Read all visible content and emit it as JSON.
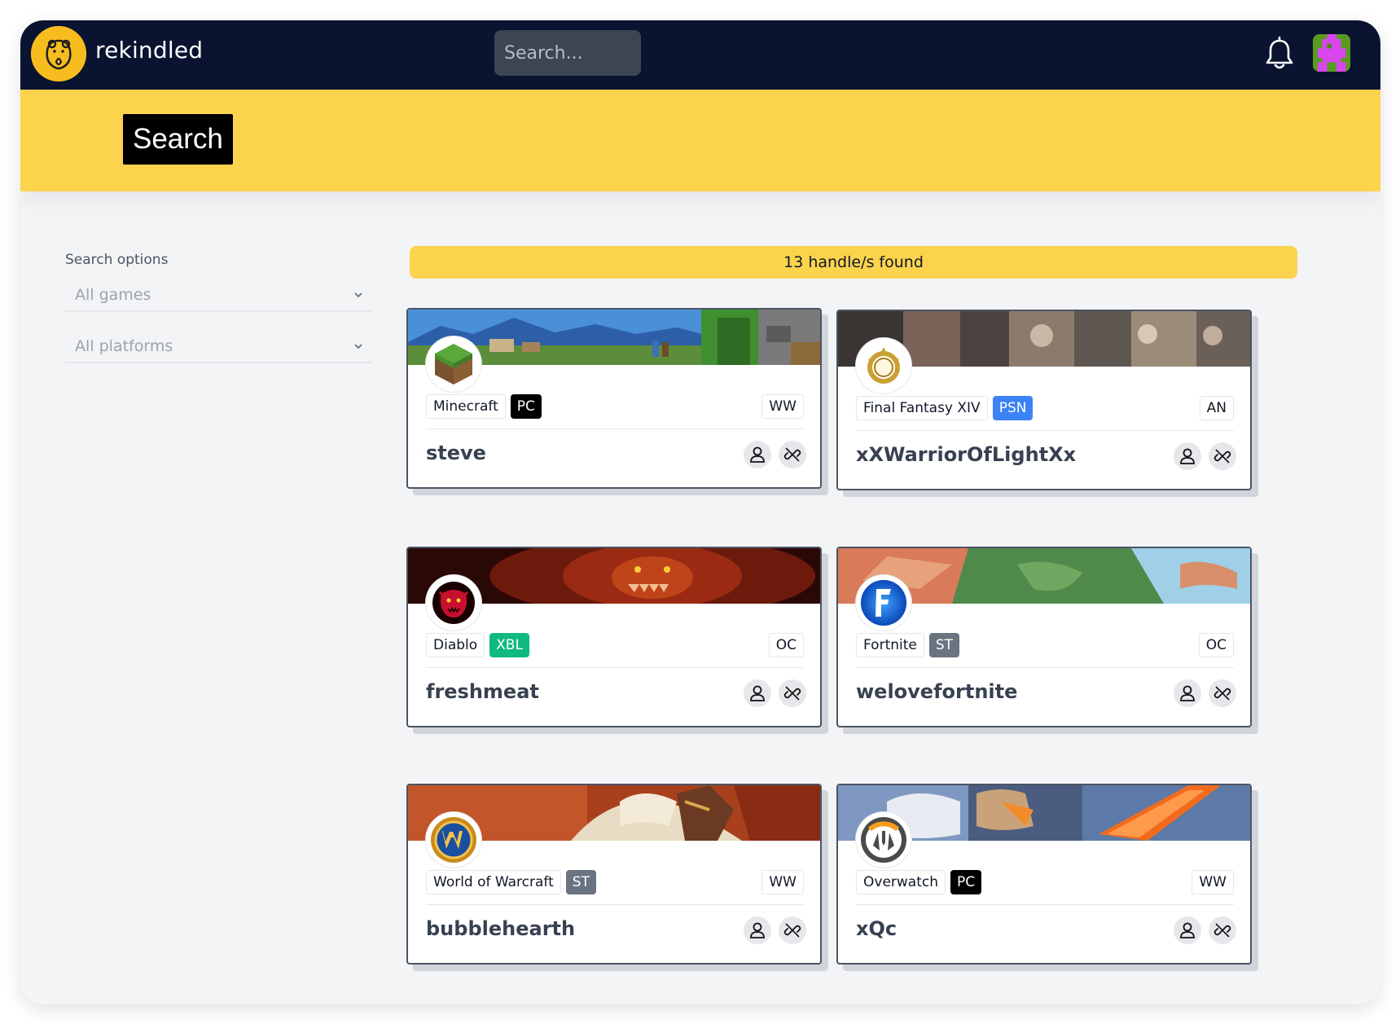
{
  "app": {
    "name": "rekindled",
    "search_placeholder": "Search...",
    "colors": {
      "navbar": "#0a1330",
      "accent": "#fcd34d",
      "logo": "#f7bd1f"
    }
  },
  "header": {
    "title": "Search"
  },
  "sidebar": {
    "label": "Search options",
    "games_select": {
      "value": "All games"
    },
    "platforms_select": {
      "value": "All platforms"
    }
  },
  "results": {
    "banner": "13 handle/s found",
    "cards": [
      {
        "game": "Minecraft",
        "platform": "PC",
        "platform_color": "#000000",
        "region": "WW",
        "handle": "steve",
        "logo_icon": "minecraft-grass-block-icon"
      },
      {
        "game": "Final Fantasy XIV",
        "platform": "PSN",
        "platform_color": "#3b82f6",
        "region": "AN",
        "handle": "xXWarriorOfLightXx",
        "logo_icon": "ffxiv-crystal-icon"
      },
      {
        "game": "Diablo",
        "platform": "XBL",
        "platform_color": "#10b981",
        "region": "OC",
        "handle": "freshmeat",
        "logo_icon": "diablo-demon-icon"
      },
      {
        "game": "Fortnite",
        "platform": "ST",
        "platform_color": "#6b7280",
        "region": "OC",
        "handle": "welovefortnite",
        "logo_icon": "fortnite-f-icon"
      },
      {
        "game": "World of Warcraft",
        "platform": "ST",
        "platform_color": "#6b7280",
        "region": "WW",
        "handle": "bubblehearth",
        "logo_icon": "wow-w-icon"
      },
      {
        "game": "Overwatch",
        "platform": "PC",
        "platform_color": "#000000",
        "region": "WW",
        "handle": "xQc",
        "logo_icon": "overwatch-icon"
      }
    ]
  }
}
